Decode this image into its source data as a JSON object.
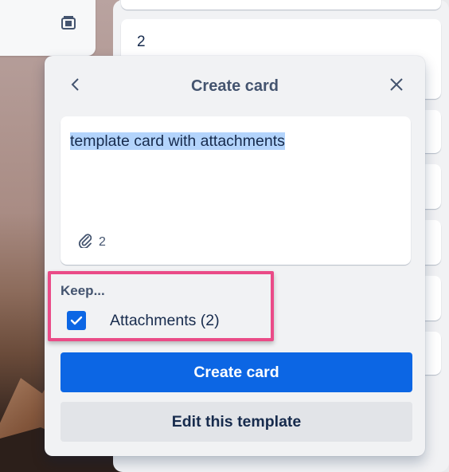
{
  "background_card": {
    "icon": "card-template-icon"
  },
  "list_cards": [
    {
      "number": ""
    },
    {
      "number": "2"
    }
  ],
  "popover": {
    "title": "Create card",
    "back_icon": "chevron-left-icon",
    "close_icon": "close-icon",
    "card_title": "template card with attachments",
    "attachment_count": "2",
    "attachment_icon": "paperclip-icon",
    "keep_heading": "Keep...",
    "keep_option_label": "Attachments (2)",
    "keep_option_checked": true,
    "create_button": "Create card",
    "edit_button": "Edit this template"
  },
  "colors": {
    "primary": "#0c66e4",
    "highlight": "#ea4b87",
    "selection": "#b3d4fc"
  }
}
